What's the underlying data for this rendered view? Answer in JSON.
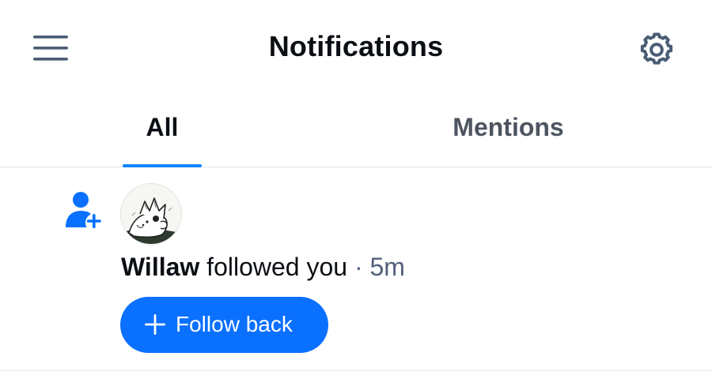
{
  "header": {
    "title": "Notifications",
    "menu_icon": "hamburger-menu-icon",
    "settings_icon": "gear-icon"
  },
  "tabs": [
    {
      "label": "All",
      "selected": true
    },
    {
      "label": "Mentions",
      "selected": false
    }
  ],
  "notifications": [
    {
      "type_icon": "person-add-icon",
      "author": "Willaw",
      "action": "followed you",
      "separator": "·",
      "time": "5m",
      "button": {
        "label": "Follow back",
        "icon": "plus-icon"
      }
    }
  ],
  "colors": {
    "accent": "#0a70ff",
    "tab_indicator": "#1083fe",
    "icon_gray": "#4b5d75",
    "text_primary": "#0b0f14",
    "text_secondary": "#52607a",
    "divider": "#dde2e7"
  }
}
